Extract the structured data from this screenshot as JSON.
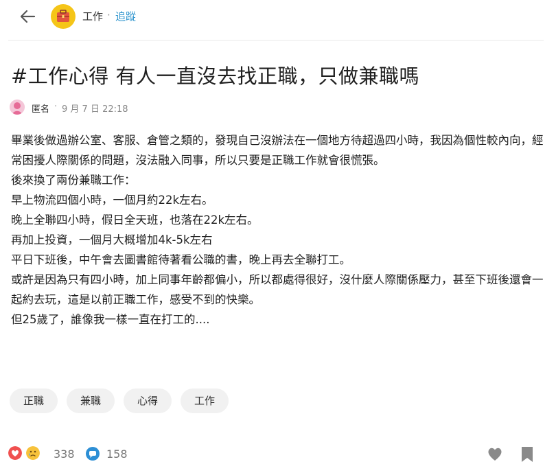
{
  "header": {
    "board_name": "工作",
    "separator": "·",
    "follow_label": "追蹤"
  },
  "post": {
    "title": "#工作心得 有人一直沒去找正職，只做兼職嗎",
    "author": "匿名",
    "separator": "·",
    "time": "9 月 7 日 22:18",
    "paragraphs": [
      "畢業後做過辦公室、客服、倉管之類的，發現自己沒辦法在一個地方待超過四小時，我因為個性較內向，經常困擾人際關係的問題，沒法融入同事，所以只要是正職工作就會很慌張。",
      "後來換了兩份兼職工作：",
      "早上物流四個小時，一個月約22k左右。",
      "晚上全聯四小時，假日全天班，也落在22k左右。",
      "再加上投資，一個月大概增加4k-5k左右",
      "平日下班後，中午會去圖書館待著看公職的書，晚上再去全聯打工。",
      "或許是因為只有四小時，加上同事年齡都偏小，所以都處得很好，沒什麼人際關係壓力，甚至下班後還會一起約去玩，這是以前正職工作，感受不到的快樂。",
      "但25歲了，誰像我一樣一直在打工的...."
    ],
    "tags": [
      "正職",
      "兼職",
      "心得",
      "工作"
    ]
  },
  "footer": {
    "reaction_count": "338",
    "comment_count": "158",
    "icons": [
      "heart-reaction-icon",
      "sad-reaction-icon",
      "comment-icon",
      "like-icon",
      "bookmark-icon"
    ]
  },
  "colors": {
    "accent": "#3397cf",
    "board_icon_bg": "#f5c518",
    "reaction_red": "#f0504f",
    "reaction_yellow": "#f7c23b",
    "comment_blue": "#2d8fd5",
    "tag_bg": "#f1f1f1",
    "muted_icon": "#8a8a8a"
  }
}
